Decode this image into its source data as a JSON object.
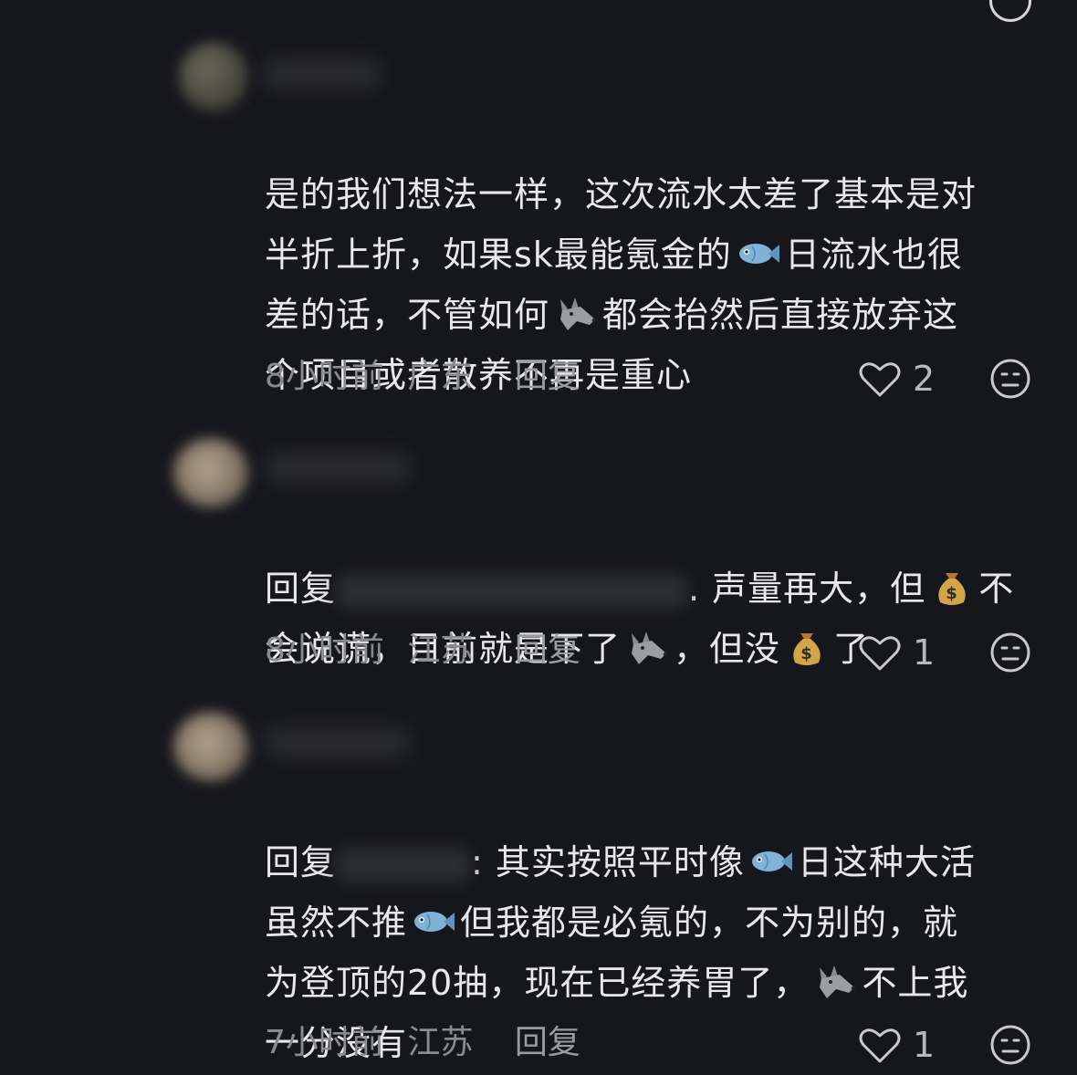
{
  "colors": {
    "background": "#16161d",
    "text": "#e8e8ec",
    "meta": "#8a8a92",
    "icon": "#c8c8ce"
  },
  "comments": [
    {
      "lines": [
        "是的我们想法一样，这次流水太差了基本是对",
        "半折上折，如果sk最能氪金的[fish]日流水也很",
        "差的话，不管如何[wolf]都会抬然后直接放弃这",
        "个项目或者散养不再是重心"
      ],
      "time": "8小时前",
      "location": "广东",
      "reply_label": "回复",
      "likes": "2"
    },
    {
      "reply_prefix": "回复",
      "after_mention": ". 声量再大，但",
      "line1_end": "不",
      "line2": "会说谎，目前就是下了",
      "line2_mid": "，但没",
      "line2_end": "了",
      "time": "8小时前",
      "location": "江苏",
      "reply_label": "回复",
      "likes": "1"
    },
    {
      "reply_prefix": "回复",
      "after_mention": ": 其实按照平时像",
      "line1_end": "日这种大活",
      "line2_a": "虽然不推",
      "line2_b": "但我都是必氪的，不为别的，就",
      "line3_a": "为登顶的20抽，现在已经养胃了，",
      "line3_b": "不上我",
      "line4": "一分没有",
      "time": "7小时前",
      "location": "江苏",
      "reply_label": "回复",
      "likes": "1"
    }
  ],
  "icons": {
    "like": "heart-outline-icon",
    "dislike": "meh-face-icon",
    "fish": "fish-emoji",
    "wolf": "wolf-emoji",
    "money": "money-bag-emoji"
  }
}
